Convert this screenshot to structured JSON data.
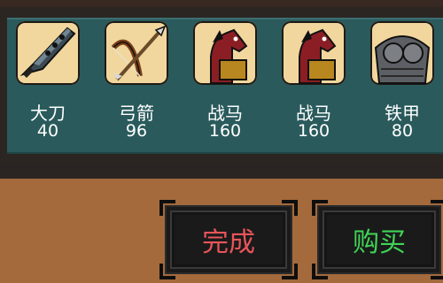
{
  "shop": {
    "items": [
      {
        "name": "大刀",
        "price": "40",
        "icon": "broadsword-icon"
      },
      {
        "name": "弓箭",
        "price": "96",
        "icon": "bow-arrow-icon"
      },
      {
        "name": "战马",
        "price": "160",
        "icon": "warhorse-icon"
      },
      {
        "name": "战马",
        "price": "160",
        "icon": "warhorse-icon"
      },
      {
        "name": "铁甲",
        "price": "80",
        "icon": "iron-armor-icon"
      }
    ]
  },
  "actions": {
    "done_label": "完成",
    "buy_label": "购买"
  },
  "colors": {
    "done_text": "#e8555a",
    "buy_text": "#3fd456",
    "panel_teal": "#2a5a5c",
    "background": "#a46a3c"
  }
}
